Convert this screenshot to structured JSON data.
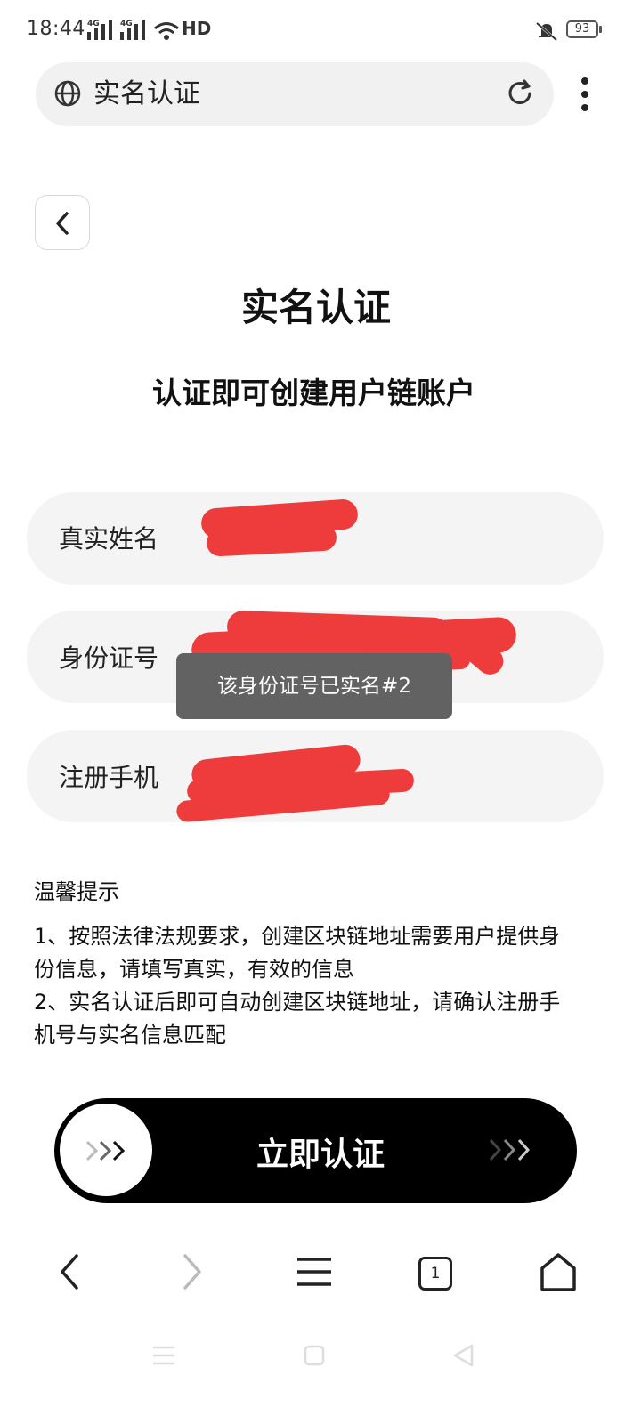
{
  "status_bar": {
    "time": "18:44",
    "network1": "4G",
    "network2": "4G",
    "hd": "HD",
    "battery": "93"
  },
  "address_bar": {
    "title": "实名认证"
  },
  "page": {
    "title": "实名认证",
    "subtitle": "认证即可创建用户链账户"
  },
  "form": {
    "fields": [
      {
        "label": "真实姓名"
      },
      {
        "label": "身份证号"
      },
      {
        "label": "注册手机"
      }
    ]
  },
  "toast": "该身份证号已实名#2",
  "tips": {
    "title": "温馨提示",
    "lines": [
      "1、按照法律法规要求，创建区块链地址需要用户提供身",
      "份信息，请填写真实，有效的信息",
      "2、实名认证后即可自动创建区块链地址，请确认注册手",
      "机号与实名信息匹配"
    ]
  },
  "slider": {
    "label": "立即认证"
  },
  "browser_nav": {
    "tab_count": "1"
  },
  "colors": {
    "redaction": "#ee3b3b",
    "slider_bg": "#000000",
    "field_bg": "#f4f4f4"
  }
}
